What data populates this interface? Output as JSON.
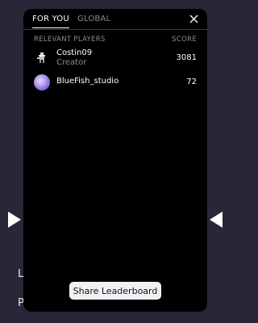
{
  "tabs": [
    {
      "label": "FOR YOU",
      "active": true
    },
    {
      "label": "GLOBAL",
      "active": false
    }
  ],
  "columns": {
    "player": "RELEVANT PLAYERS",
    "score": "SCORE"
  },
  "players": [
    {
      "name": "Costin09",
      "subtitle": "Creator",
      "score": "3081",
      "avatar": "pixel-character-avatar"
    },
    {
      "name": "BlueFish_studio",
      "subtitle": "",
      "score": "72",
      "avatar": "purple-gradient-avatar"
    }
  ],
  "share_label": "Share Leaderboard",
  "background": {
    "text1": "L",
    "text2": "P"
  },
  "colors": {
    "modal": "#000000",
    "backdrop": "#2a2637",
    "button": "#f1f0f5"
  }
}
